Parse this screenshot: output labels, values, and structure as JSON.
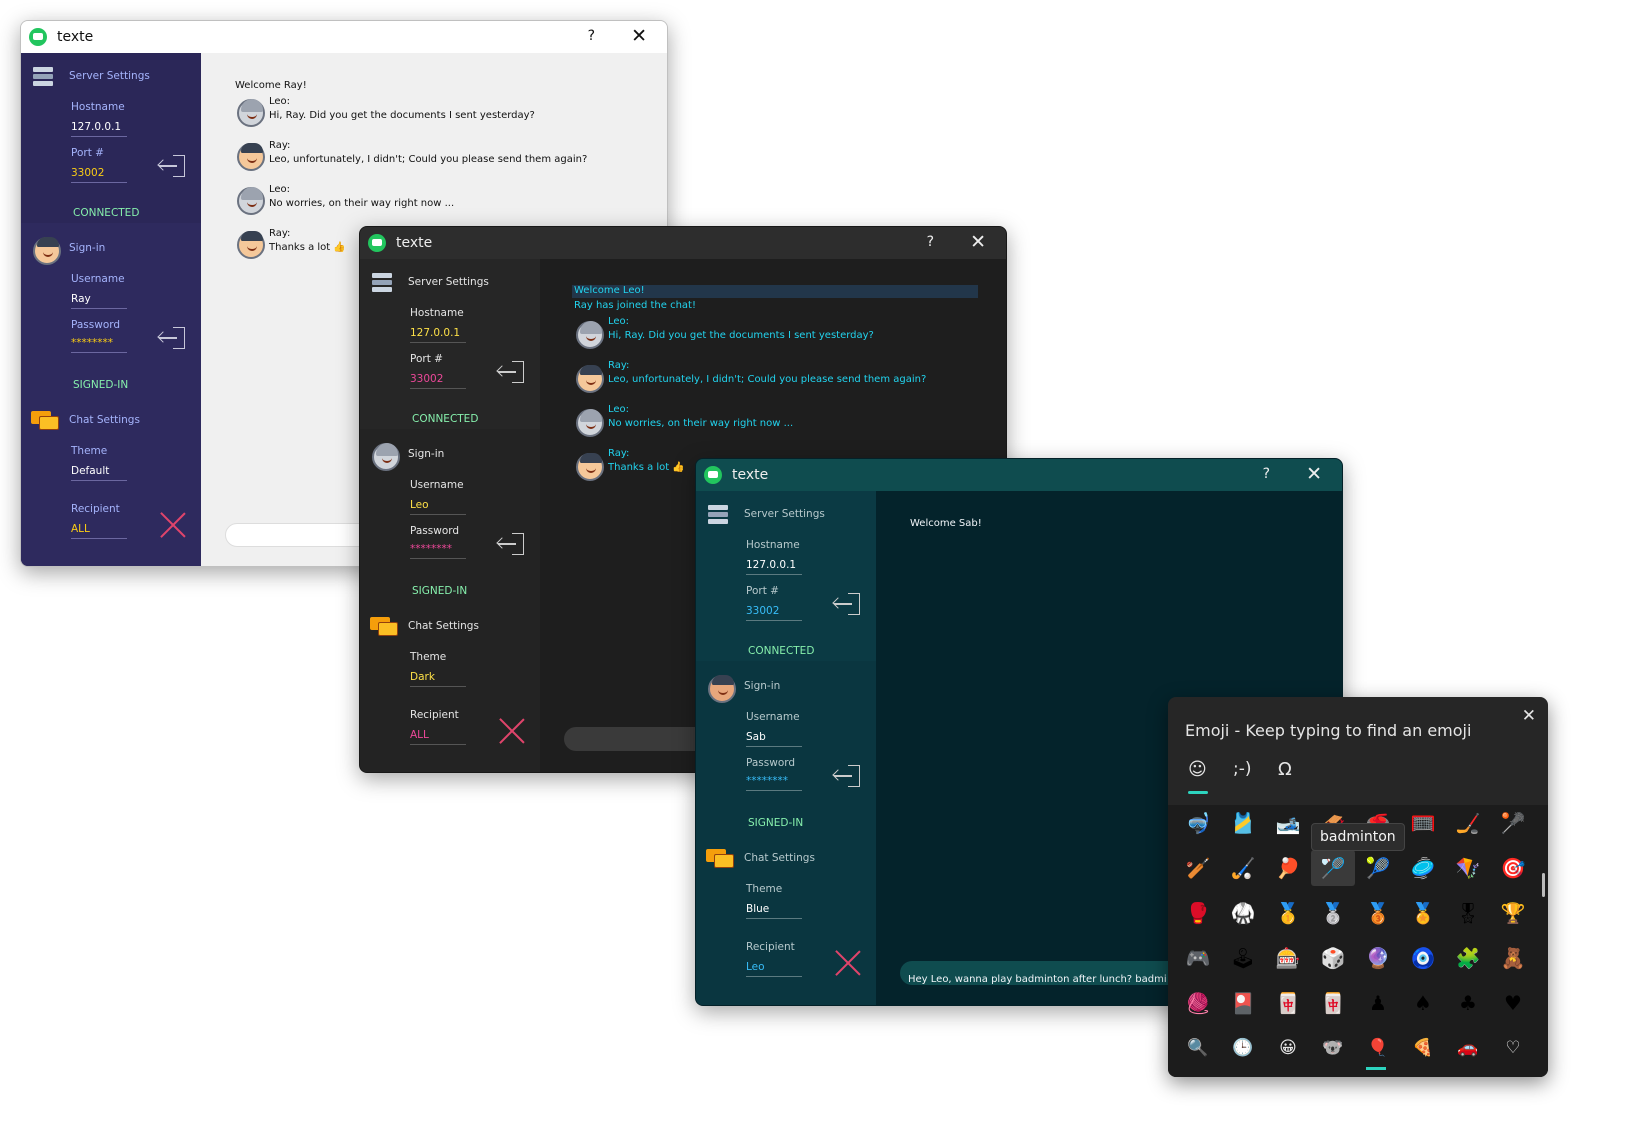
{
  "app": {
    "title": "texte",
    "help": "?",
    "close": "✕"
  },
  "labels": {
    "server_settings": "Server Settings",
    "hostname": "Hostname",
    "port": "Port #",
    "connected": "CONNECTED",
    "signin": "Sign-in",
    "username": "Username",
    "password": "Password",
    "signed_in": "SIGNED-IN",
    "chat_settings": "Chat Settings",
    "theme": "Theme",
    "recipient": "Recipient"
  },
  "light": {
    "hostname": "127.0.0.1",
    "port": "33002",
    "username": "Ray",
    "password": "********",
    "theme": "Default",
    "recipient": "ALL",
    "messages": [
      {
        "text": "Welcome Ray!"
      },
      {
        "sender": "Leo:",
        "text": "Hi, Ray. Did you get the documents I sent yesterday?"
      },
      {
        "sender": "Ray:",
        "text": "Leo, unfortunately, I didn't; Could you please send them again?"
      },
      {
        "sender": "Leo:",
        "text": "No worries, on their way right now ..."
      },
      {
        "sender": "Ray:",
        "text": "Thanks a lot 👍"
      }
    ]
  },
  "dark": {
    "hostname": "127.0.0.1",
    "port": "33002",
    "username": "Leo",
    "password": "********",
    "theme": "Dark",
    "recipient": "ALL",
    "messages": [
      {
        "text": "Welcome Leo!"
      },
      {
        "text": "Ray has joined the chat!"
      },
      {
        "sender": "Leo:",
        "text": "Hi, Ray. Did you get the documents I sent yesterday?"
      },
      {
        "sender": "Ray:",
        "text": "Leo, unfortunately, I didn't; Could you please send them again?"
      },
      {
        "sender": "Leo:",
        "text": "No worries, on their way right now ..."
      },
      {
        "sender": "Ray:",
        "text": "Thanks a lot 👍"
      }
    ]
  },
  "blue": {
    "hostname": "127.0.0.1",
    "port": "33002",
    "username": "Sab",
    "password": "********",
    "theme": "Blue",
    "recipient": "Leo",
    "messages": [
      {
        "text": "Welcome Sab!"
      }
    ],
    "input_text": "Hey Leo, wanna play badminton after lunch? badmi"
  },
  "emoji_panel": {
    "title": "Emoji - Keep typing to find an emoji",
    "tabs": [
      "☺",
      ";-)",
      "Ω"
    ],
    "tooltip": "badminton",
    "rows": [
      [
        "🤿",
        "🎽",
        "🎿",
        "🛷",
        "🥌",
        "🥅",
        "🏒",
        "🥍"
      ],
      [
        "🏏",
        "🏑",
        "🏓",
        "🏸",
        "🎾",
        "🥏",
        "🪁",
        "🎯"
      ],
      [
        "🥊",
        "🥋",
        "🥇",
        "🥈",
        "🥉",
        "🏅",
        "🎖",
        "🏆"
      ],
      [
        "🎮",
        "🕹",
        "🎰",
        "🎲",
        "🔮",
        "🧿",
        "🧩",
        "🧸"
      ],
      [
        "🧶",
        "🎴",
        "🀄",
        "🀄",
        "♟",
        "♠",
        "♣",
        "♥"
      ]
    ],
    "bottom_icons": [
      "🔍",
      "🕒",
      "😀",
      "🐨",
      "🎈",
      "🍕",
      "🚗",
      "♡"
    ]
  }
}
